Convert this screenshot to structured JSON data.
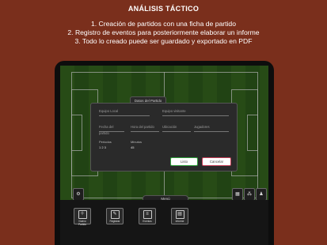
{
  "header": {
    "title": "ANÁLISIS TÁCTICO",
    "lines": [
      "1. Creación de partidos con una ficha de partido",
      "2. Registro de eventos para posteriormente elaborar un informe",
      "3. Todo lo creado puede ser guardado y exportado en PDF"
    ]
  },
  "dialog": {
    "tab": "Datos del Partido",
    "fields": {
      "local": "Equipo Local",
      "visitante": "Equipo visitante",
      "fecha": "Fecha del partido",
      "hora": "Hora del partido",
      "ubicacion": "Ubicación",
      "jugadores": "Jugadores"
    },
    "periodos_label": "Periodos",
    "periodos_value": "1  2  3",
    "minutos_label": "Minutos",
    "minutos_value": "45",
    "cancel": "Listo",
    "confirm": "Cancelar"
  },
  "menu": {
    "tab": "Menú",
    "buttons": [
      "Nuevo Partido",
      "Registrar",
      "Eventos",
      "Informe"
    ]
  },
  "colors": {
    "background": "#7a2f1c",
    "pitch": "#2f5d1d",
    "cancel_border": "#2e9e3a",
    "confirm_border": "#c43d55"
  }
}
